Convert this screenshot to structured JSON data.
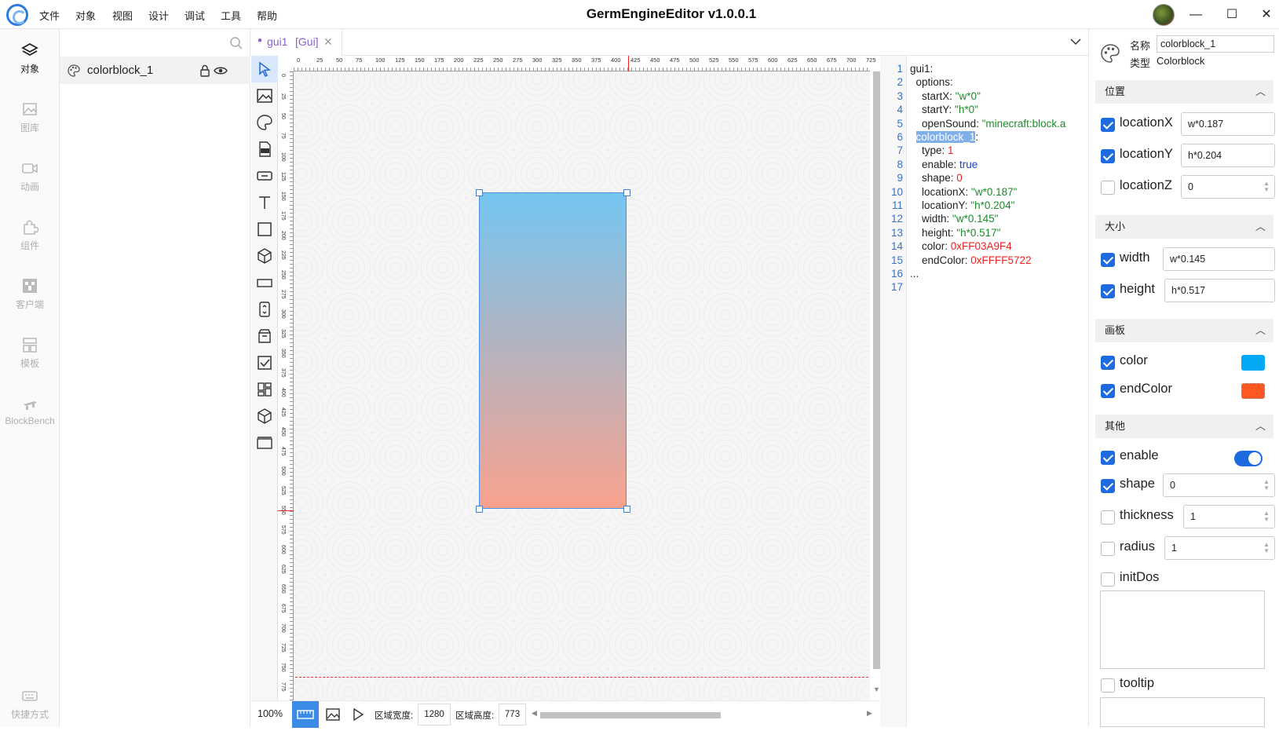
{
  "menu": [
    "文件",
    "对象",
    "视图",
    "设计",
    "调试",
    "工具",
    "帮助"
  ],
  "app_title": "GermEngineEditor v1.0.0.1",
  "window_controls": {
    "minimize": "—",
    "maximize": "☐",
    "close": "✕"
  },
  "left_nav": [
    {
      "label": "对象",
      "icon": "layers-icon",
      "active": true
    },
    {
      "label": "图库",
      "icon": "image-icon",
      "active": false
    },
    {
      "label": "动画",
      "icon": "video-icon",
      "active": false
    },
    {
      "label": "组件",
      "icon": "puzzle-icon",
      "active": false
    },
    {
      "label": "客户端",
      "icon": "creeper-icon",
      "active": false
    },
    {
      "label": "模板",
      "icon": "template-icon",
      "active": false
    },
    {
      "label": "BlockBench",
      "icon": "blockbench-icon",
      "active": false
    }
  ],
  "shortcuts_label": "快捷方式",
  "object_panel": {
    "search_placeholder": "",
    "items": [
      {
        "name": "colorblock_1"
      }
    ]
  },
  "tab": {
    "name": "gui1",
    "type": "[Gui]"
  },
  "ruler_h": [
    "0",
    "25",
    "50",
    "75",
    "100",
    "125",
    "150",
    "175",
    "200",
    "225",
    "250",
    "275",
    "300",
    "325",
    "350",
    "375",
    "400",
    "425",
    "450",
    "475",
    "500",
    "525",
    "550",
    "575",
    "600",
    "625",
    "650",
    "675",
    "700",
    "725"
  ],
  "ruler_v": [
    "0",
    "25",
    "50",
    "75",
    "100",
    "125",
    "150",
    "175",
    "200",
    "225",
    "250",
    "275",
    "300",
    "325",
    "350",
    "375",
    "400",
    "425",
    "450",
    "475",
    "500",
    "525",
    "550",
    "575",
    "600",
    "625",
    "650",
    "675",
    "700",
    "725",
    "750",
    "775"
  ],
  "bottom_bar": {
    "zoom": "100%",
    "width_label": "区域宽度:",
    "width_value": "1280",
    "height_label": "区域高度:",
    "height_value": "773"
  },
  "code_lines": [
    {
      "n": "1",
      "t": "gui1:"
    },
    {
      "n": "2",
      "t": "  options:"
    },
    {
      "n": "3",
      "k": "    startX: ",
      "v": "\"w*0\"",
      "c": "str"
    },
    {
      "n": "4",
      "k": "    startY: ",
      "v": "\"h*0\"",
      "c": "str"
    },
    {
      "n": "5",
      "k": "    openSound: ",
      "v": "\"minecraft:block.a",
      "c": "str"
    },
    {
      "n": "6",
      "hl": "colorblock_1",
      "t2": ":"
    },
    {
      "n": "7",
      "k": "    type: ",
      "v": "1",
      "c": "num"
    },
    {
      "n": "8",
      "k": "    enable: ",
      "v": "true",
      "c": "kw"
    },
    {
      "n": "9",
      "k": "    shape: ",
      "v": "0",
      "c": "num"
    },
    {
      "n": "10",
      "k": "    locationX: ",
      "v": "\"w*0.187\"",
      "c": "str"
    },
    {
      "n": "11",
      "k": "    locationY: ",
      "v": "\"h*0.204\"",
      "c": "str"
    },
    {
      "n": "12",
      "k": "    width: ",
      "v": "\"w*0.145\"",
      "c": "str"
    },
    {
      "n": "13",
      "k": "    height: ",
      "v": "\"h*0.517\"",
      "c": "str"
    },
    {
      "n": "14",
      "k": "    color: ",
      "v": "0xFF03A9F4",
      "c": "num"
    },
    {
      "n": "15",
      "k": "    endColor: ",
      "v": "0xFFFF5722",
      "c": "num"
    },
    {
      "n": "16",
      "t": "..."
    },
    {
      "n": "17",
      "t": ""
    }
  ],
  "props": {
    "name_label": "名称",
    "name_value": "colorblock_1",
    "type_label": "类型",
    "type_value": "Colorblock",
    "sections": {
      "position": "位置",
      "size": "大小",
      "canvas": "画板",
      "other": "其他"
    },
    "locationX": {
      "label": "locationX",
      "value": "w*0.187",
      "checked": true
    },
    "locationY": {
      "label": "locationY",
      "value": "h*0.204",
      "checked": true
    },
    "locationZ": {
      "label": "locationZ",
      "value": "0",
      "checked": false
    },
    "width": {
      "label": "width",
      "value": "w*0.145",
      "checked": true
    },
    "height": {
      "label": "height",
      "value": "h*0.517",
      "checked": true
    },
    "color": {
      "label": "color",
      "value": "#03A9F4",
      "checked": true
    },
    "endColor": {
      "label": "endColor",
      "value": "#FF5722",
      "checked": true
    },
    "enable": {
      "label": "enable",
      "checked": true,
      "on": true
    },
    "shape": {
      "label": "shape",
      "value": "0",
      "checked": true
    },
    "thickness": {
      "label": "thickness",
      "value": "1",
      "checked": false
    },
    "radius": {
      "label": "radius",
      "value": "1",
      "checked": false
    },
    "initDos": {
      "label": "initDos",
      "checked": false
    },
    "tooltip": {
      "label": "tooltip",
      "checked": false
    }
  },
  "colors": {
    "accent": "#1e6ae0",
    "block_top": "#74c6f2",
    "block_bottom": "#f9a28e"
  }
}
